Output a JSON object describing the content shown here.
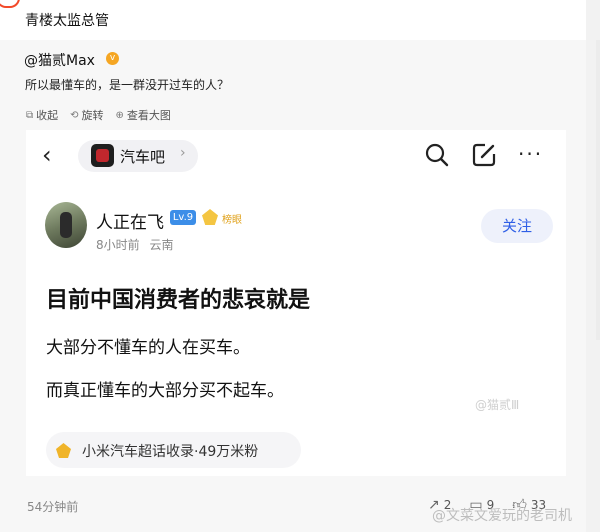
{
  "post": {
    "category": "青楼太监总管",
    "author": "@猫贰Max",
    "verified_badge": "v",
    "text": "所以最懂车的，是一群没开过车的人？",
    "actions": {
      "collapse": "收起",
      "rotate": "旋转",
      "view_large": "查看大图"
    },
    "timestamp": "54分钟前",
    "stats": {
      "reposts": "2",
      "comments": "9",
      "likes": "33"
    },
    "overlay_watermark": "@文菜文爱玩的老司机"
  },
  "screenshot": {
    "bar": {
      "name": "汽车吧"
    },
    "user": {
      "name": "人正在飞",
      "level": "Lv.9",
      "medal_label": "榜眼",
      "time": "8小时前",
      "location": "云南",
      "follow_label": "关注"
    },
    "headline": "目前中国消费者的悲哀就是",
    "lines": [
      "大部分不懂车的人在买车。",
      "而真正懂车的大部分买不起车。"
    ],
    "watermark": "@猫贰Ⅲ",
    "topic": "小米汽车超话收录·49万米粉"
  },
  "colors": {
    "accent_blue": "#2f5fe6",
    "verified_orange": "#f5a623",
    "level_blue": "#3c8ee8",
    "gold": "#f4c542"
  }
}
